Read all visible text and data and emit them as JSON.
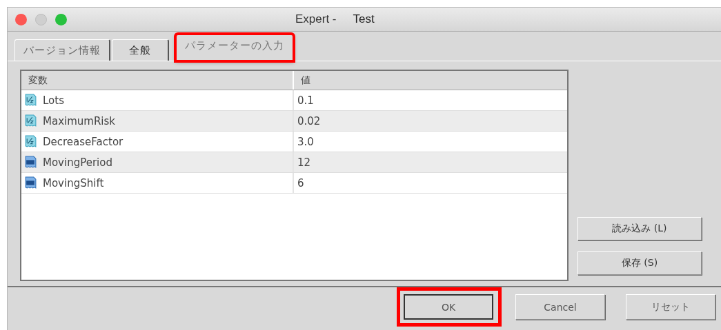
{
  "window": {
    "title": "Expert -",
    "subtitle": "Test"
  },
  "tabs": [
    {
      "label": "バージョン情報",
      "selected": false,
      "highlighted": false
    },
    {
      "label": "全般",
      "selected": false,
      "highlighted": false
    },
    {
      "label": "パラメーターの入力",
      "selected": true,
      "highlighted": true
    }
  ],
  "table": {
    "columns": [
      "変数",
      "値"
    ],
    "rows": [
      {
        "kind": "double",
        "name": "Lots",
        "value": "0.1"
      },
      {
        "kind": "double",
        "name": "MaximumRisk",
        "value": "0.02"
      },
      {
        "kind": "double",
        "name": "DecreaseFactor",
        "value": "3.0"
      },
      {
        "kind": "int",
        "name": "MovingPeriod",
        "value": "12"
      },
      {
        "kind": "int",
        "name": "MovingShift",
        "value": "6"
      }
    ]
  },
  "side_buttons": [
    "読み込み (L)",
    "保存 (S)"
  ],
  "buttons": [
    {
      "label": "OK",
      "highlighted": true
    },
    {
      "label": "Cancel",
      "highlighted": false
    },
    {
      "label": "リセット",
      "highlighted": false
    }
  ]
}
